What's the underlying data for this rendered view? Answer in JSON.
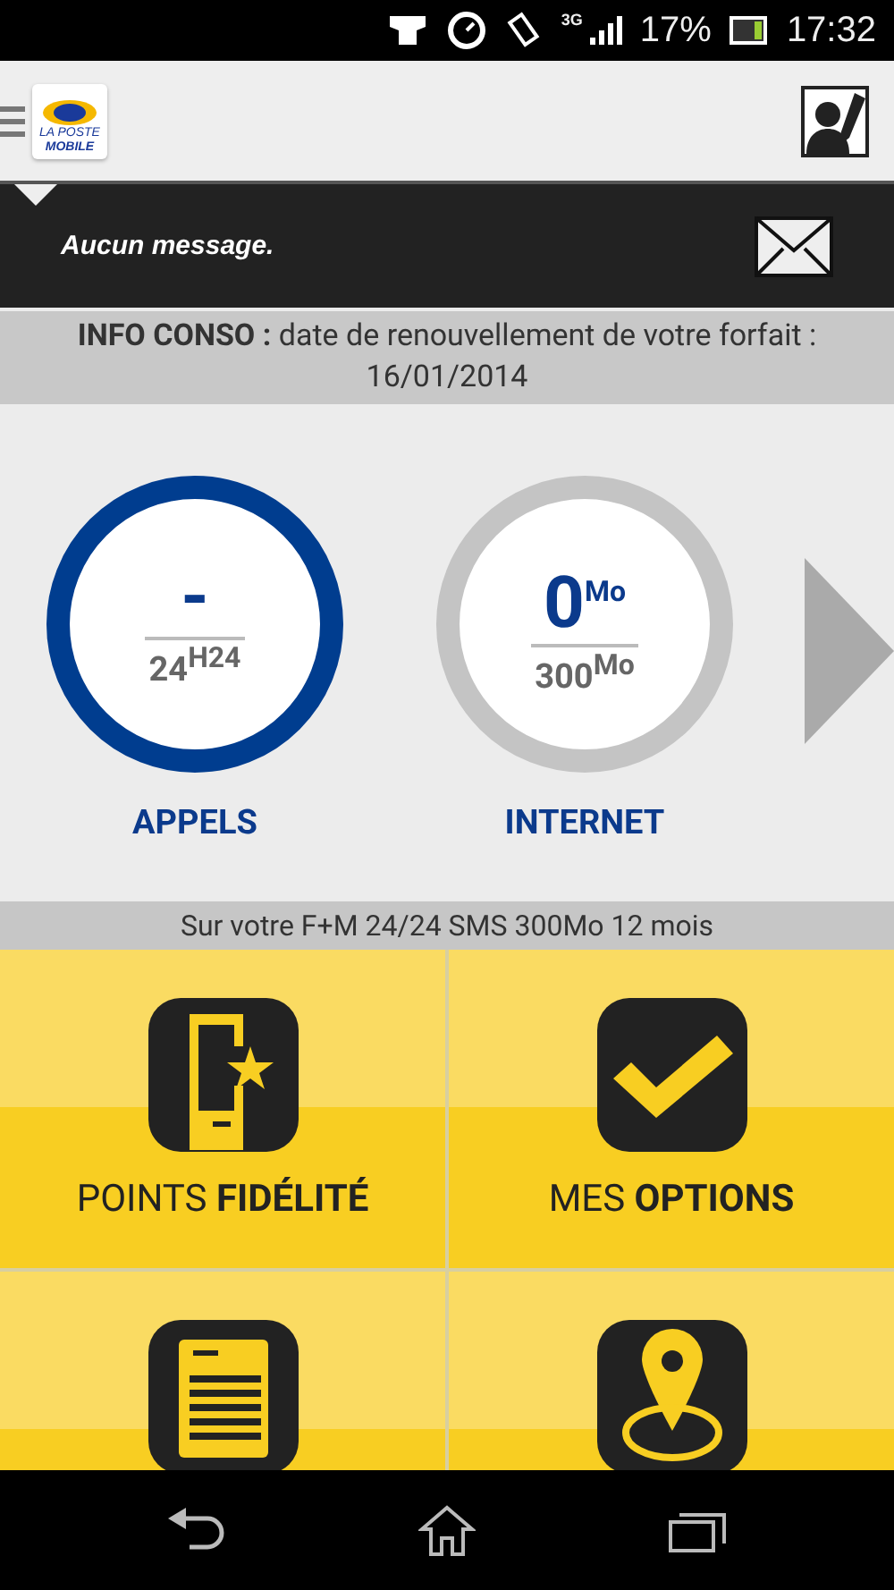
{
  "status_bar": {
    "network": "3G",
    "battery": "17%",
    "time": "17:32"
  },
  "app_bar": {
    "logo": {
      "line_1": "LA POSTE",
      "line_2": "MOBILE"
    }
  },
  "message_bar": {
    "text": "Aucun message."
  },
  "info_banner": {
    "label": "INFO CONSO :",
    "text": "date de renouvellement de votre forfait : 16/01/2014"
  },
  "gauges": [
    {
      "label": "APPELS",
      "value": "-",
      "total": "24",
      "total_unit": "H24",
      "color": "#003d8f"
    },
    {
      "label": "INTERNET",
      "value": "0",
      "value_unit": "Mo",
      "total": "300",
      "total_unit": "Mo",
      "color": "#c4c4c4"
    }
  ],
  "plan": "Sur votre F+M 24/24 SMS 300Mo 12 mois",
  "tiles": [
    {
      "kind": "phone-star",
      "label": "POINTS **FIDÉLITÉ**"
    },
    {
      "kind": "check",
      "label": "MES **OPTIONS**"
    },
    {
      "kind": "document"
    },
    {
      "kind": "location"
    }
  ]
}
